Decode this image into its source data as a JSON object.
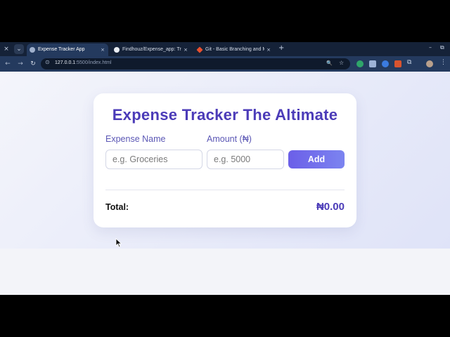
{
  "browser": {
    "tabs": [
      {
        "title": "Expense Tracker App",
        "active": true
      },
      {
        "title": "Findhouz/Expense_app: Tra",
        "active": false
      },
      {
        "title": "Git - Basic Branching and Me",
        "active": false
      }
    ],
    "url_host": "127.0.0.1",
    "url_rest": ":5500/index.html",
    "icons": {
      "close": "×",
      "tab_list": "⌄",
      "new_tab": "+",
      "back": "←",
      "forward": "→",
      "reload": "↻",
      "site_info": "⊙",
      "zoom": "🔍",
      "bookmark": "☆",
      "extensions": "⧉",
      "menu": "⋮",
      "minimize": "–",
      "restore": "⧉"
    }
  },
  "app": {
    "title": "Expense Tracker The Altimate",
    "expense_name_label": "Expense Name",
    "expense_name_placeholder": "e.g. Groceries",
    "amount_label": "Amount (₦)",
    "amount_placeholder": "e.g. 5000",
    "add_button": "Add",
    "total_label": "Total:",
    "total_value": "₦0.00"
  },
  "colors": {
    "accent": "#4b3bb8",
    "button_start": "#6b5fe8",
    "button_end": "#7c84f0",
    "chrome_dark": "#152238",
    "chrome_toolbar": "#243a5e"
  }
}
